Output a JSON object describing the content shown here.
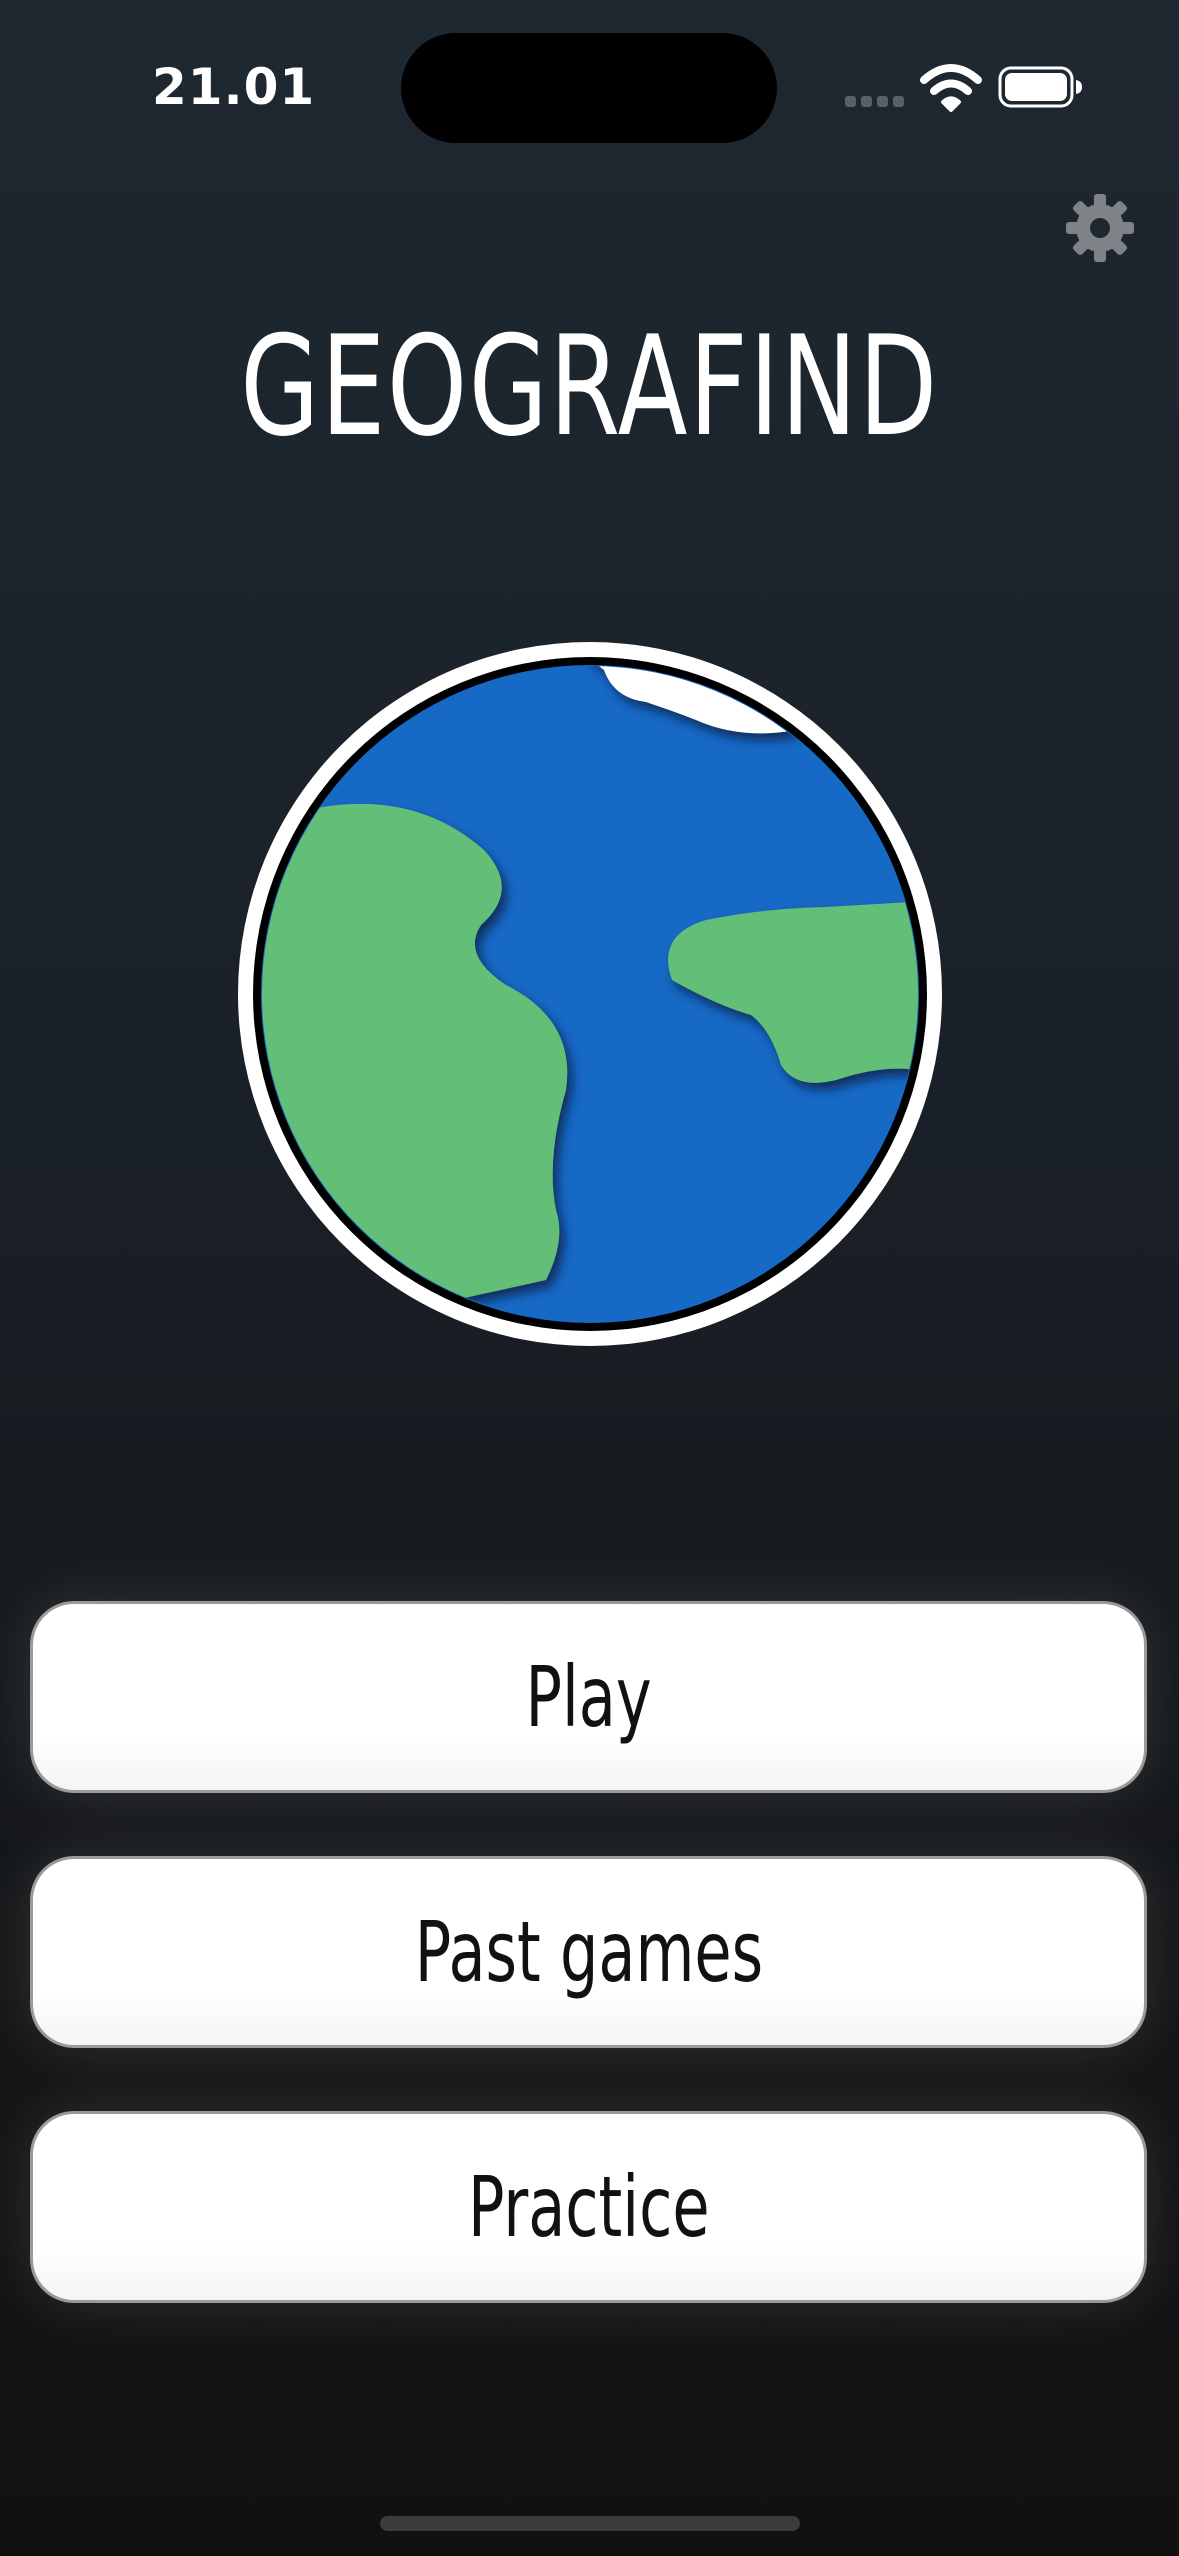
{
  "status_bar": {
    "time": "21.01"
  },
  "app": {
    "title": "GEOGRAFIND"
  },
  "menu": {
    "buttons": [
      {
        "label": "Play"
      },
      {
        "label": "Past games"
      },
      {
        "label": "Practice"
      }
    ]
  },
  "icons": {
    "settings": "gear-icon",
    "wifi": "wifi-icon",
    "battery": "battery-icon",
    "signal": "cellular-signal-icon",
    "logo": "globe-icon"
  },
  "colors": {
    "ocean": "#1769c6",
    "land": "#64bf78",
    "ice": "#ffffff",
    "background_top": "#1e2830",
    "background_bottom": "#111111",
    "button_bg": "#ffffff",
    "button_text": "#111111"
  }
}
